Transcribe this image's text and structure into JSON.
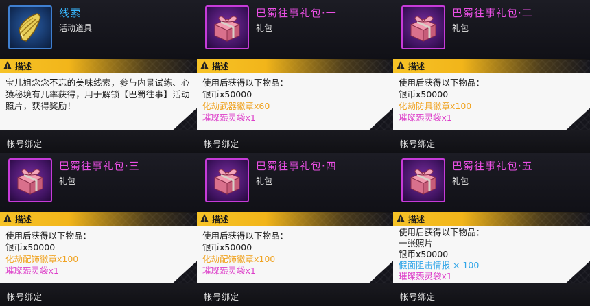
{
  "section_label": "描述",
  "bind_label": "帐号绑定",
  "cards": [
    {
      "title": "线索",
      "subtitle": "活动道具",
      "icon": "bamboo-shoot-icon",
      "frame": "blue",
      "description": "宝儿姐念念不忘的美味线索，参与内景试练、心猿秘境有几率获得，用于解锁【巴蜀往事】活动照片，获得奖励！"
    },
    {
      "title": "巴蜀往事礼包·一",
      "subtitle": "礼包",
      "icon": "gift-box-icon",
      "frame": "purple",
      "lines": [
        {
          "text": "使用后获得以下物品：",
          "color": "dark"
        },
        {
          "text": "银币x50000",
          "color": "dark"
        },
        {
          "text": "化劫武器徽章x60",
          "color": "orange"
        },
        {
          "text": "璀璨炁灵袋x1",
          "color": "pink"
        }
      ]
    },
    {
      "title": "巴蜀往事礼包·二",
      "subtitle": "礼包",
      "icon": "gift-box-icon",
      "frame": "purple",
      "lines": [
        {
          "text": "使用后获得以下物品：",
          "color": "dark"
        },
        {
          "text": "银币x50000",
          "color": "dark"
        },
        {
          "text": "化劫防具徽章x100",
          "color": "orange"
        },
        {
          "text": "璀璨炁灵袋x1",
          "color": "pink"
        }
      ]
    },
    {
      "title": "巴蜀往事礼包·三",
      "subtitle": "礼包",
      "icon": "gift-box-icon",
      "frame": "purple",
      "lines": [
        {
          "text": "使用后获得以下物品：",
          "color": "dark"
        },
        {
          "text": "银币x50000",
          "color": "dark"
        },
        {
          "text": "化劫配饰徽章x100",
          "color": "orange"
        },
        {
          "text": "璀璨炁灵袋x1",
          "color": "pink"
        }
      ]
    },
    {
      "title": "巴蜀往事礼包·四",
      "subtitle": "礼包",
      "icon": "gift-box-icon",
      "frame": "purple",
      "lines": [
        {
          "text": "使用后获得以下物品：",
          "color": "dark"
        },
        {
          "text": "银币x50000",
          "color": "dark"
        },
        {
          "text": "化劫配饰徽章x100",
          "color": "orange"
        },
        {
          "text": "璀璨炁灵袋x1",
          "color": "pink"
        }
      ]
    },
    {
      "title": "巴蜀往事礼包·五",
      "subtitle": "礼包",
      "icon": "gift-box-icon",
      "frame": "purple",
      "lines": [
        {
          "text": "使用后获得以下物品：",
          "color": "dark"
        },
        {
          "text": "一张照片",
          "color": "dark"
        },
        {
          "text": "银币x50000",
          "color": "dark"
        },
        {
          "text": "假面阻击情报 × 100",
          "color": "blue"
        },
        {
          "text": "璀璨炁灵袋x1",
          "color": "pink"
        }
      ]
    }
  ],
  "colors": {
    "title_blue": "#38b7ff",
    "title_pink": "#ea4fe4",
    "desc_gold": "#f6c327",
    "text_orange": "#f0a321",
    "text_pink": "#dd3ec9",
    "text_blue": "#2fa5e8"
  }
}
